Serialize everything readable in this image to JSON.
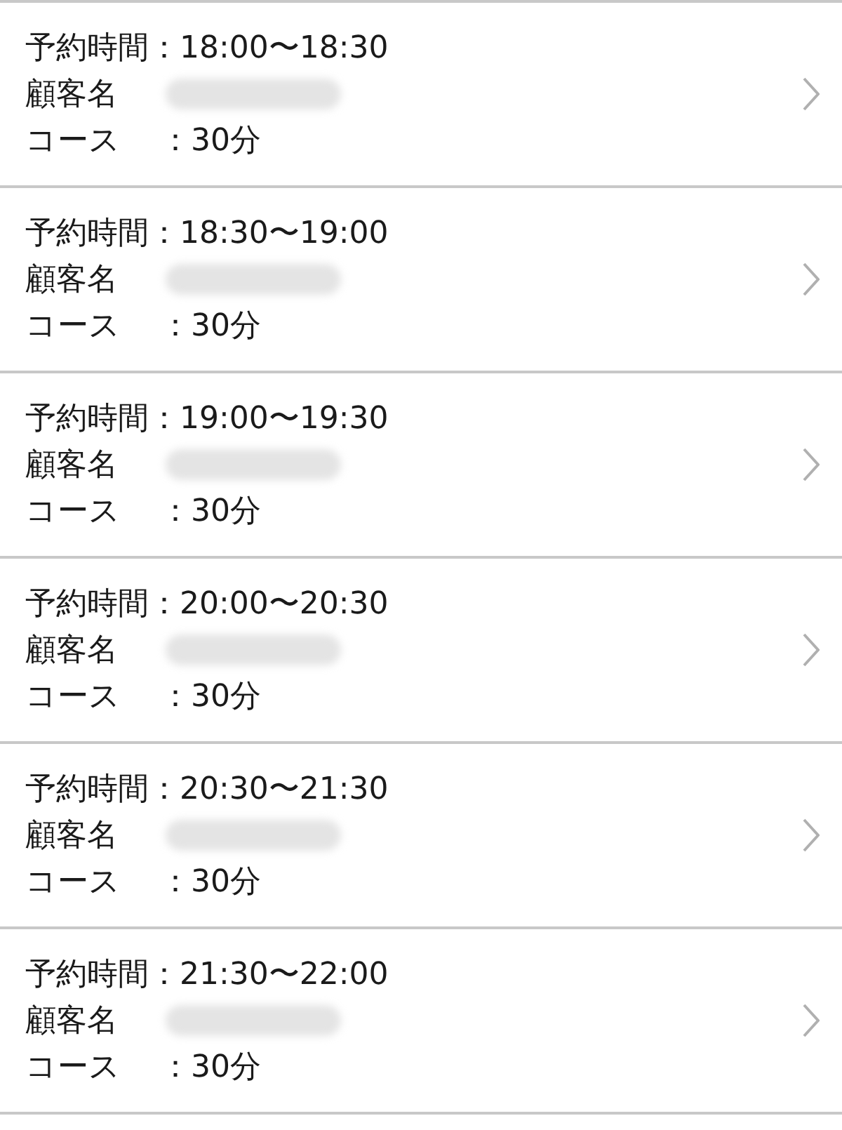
{
  "reservations": [
    {
      "time_label": "予約時間",
      "time_value": "：18:00〜18:30",
      "name_label": "顧客名",
      "course_label": "コース",
      "course_value": "：30分"
    },
    {
      "time_label": "予約時間",
      "time_value": "：18:30〜19:00",
      "name_label": "顧客名",
      "course_label": "コース",
      "course_value": "：30分"
    },
    {
      "time_label": "予約時間",
      "time_value": "：19:00〜19:30",
      "name_label": "顧客名",
      "course_label": "コース",
      "course_value": "：30分"
    },
    {
      "time_label": "予約時間",
      "time_value": "：20:00〜20:30",
      "name_label": "顧客名",
      "course_label": "コース",
      "course_value": "：30分"
    },
    {
      "time_label": "予約時間",
      "time_value": "：20:30〜21:30",
      "name_label": "顧客名",
      "course_label": "コース",
      "course_value": "：30分"
    },
    {
      "time_label": "予約時間",
      "time_value": "：21:30〜22:00",
      "name_label": "顧客名",
      "course_label": "コース",
      "course_value": "：30分"
    }
  ]
}
